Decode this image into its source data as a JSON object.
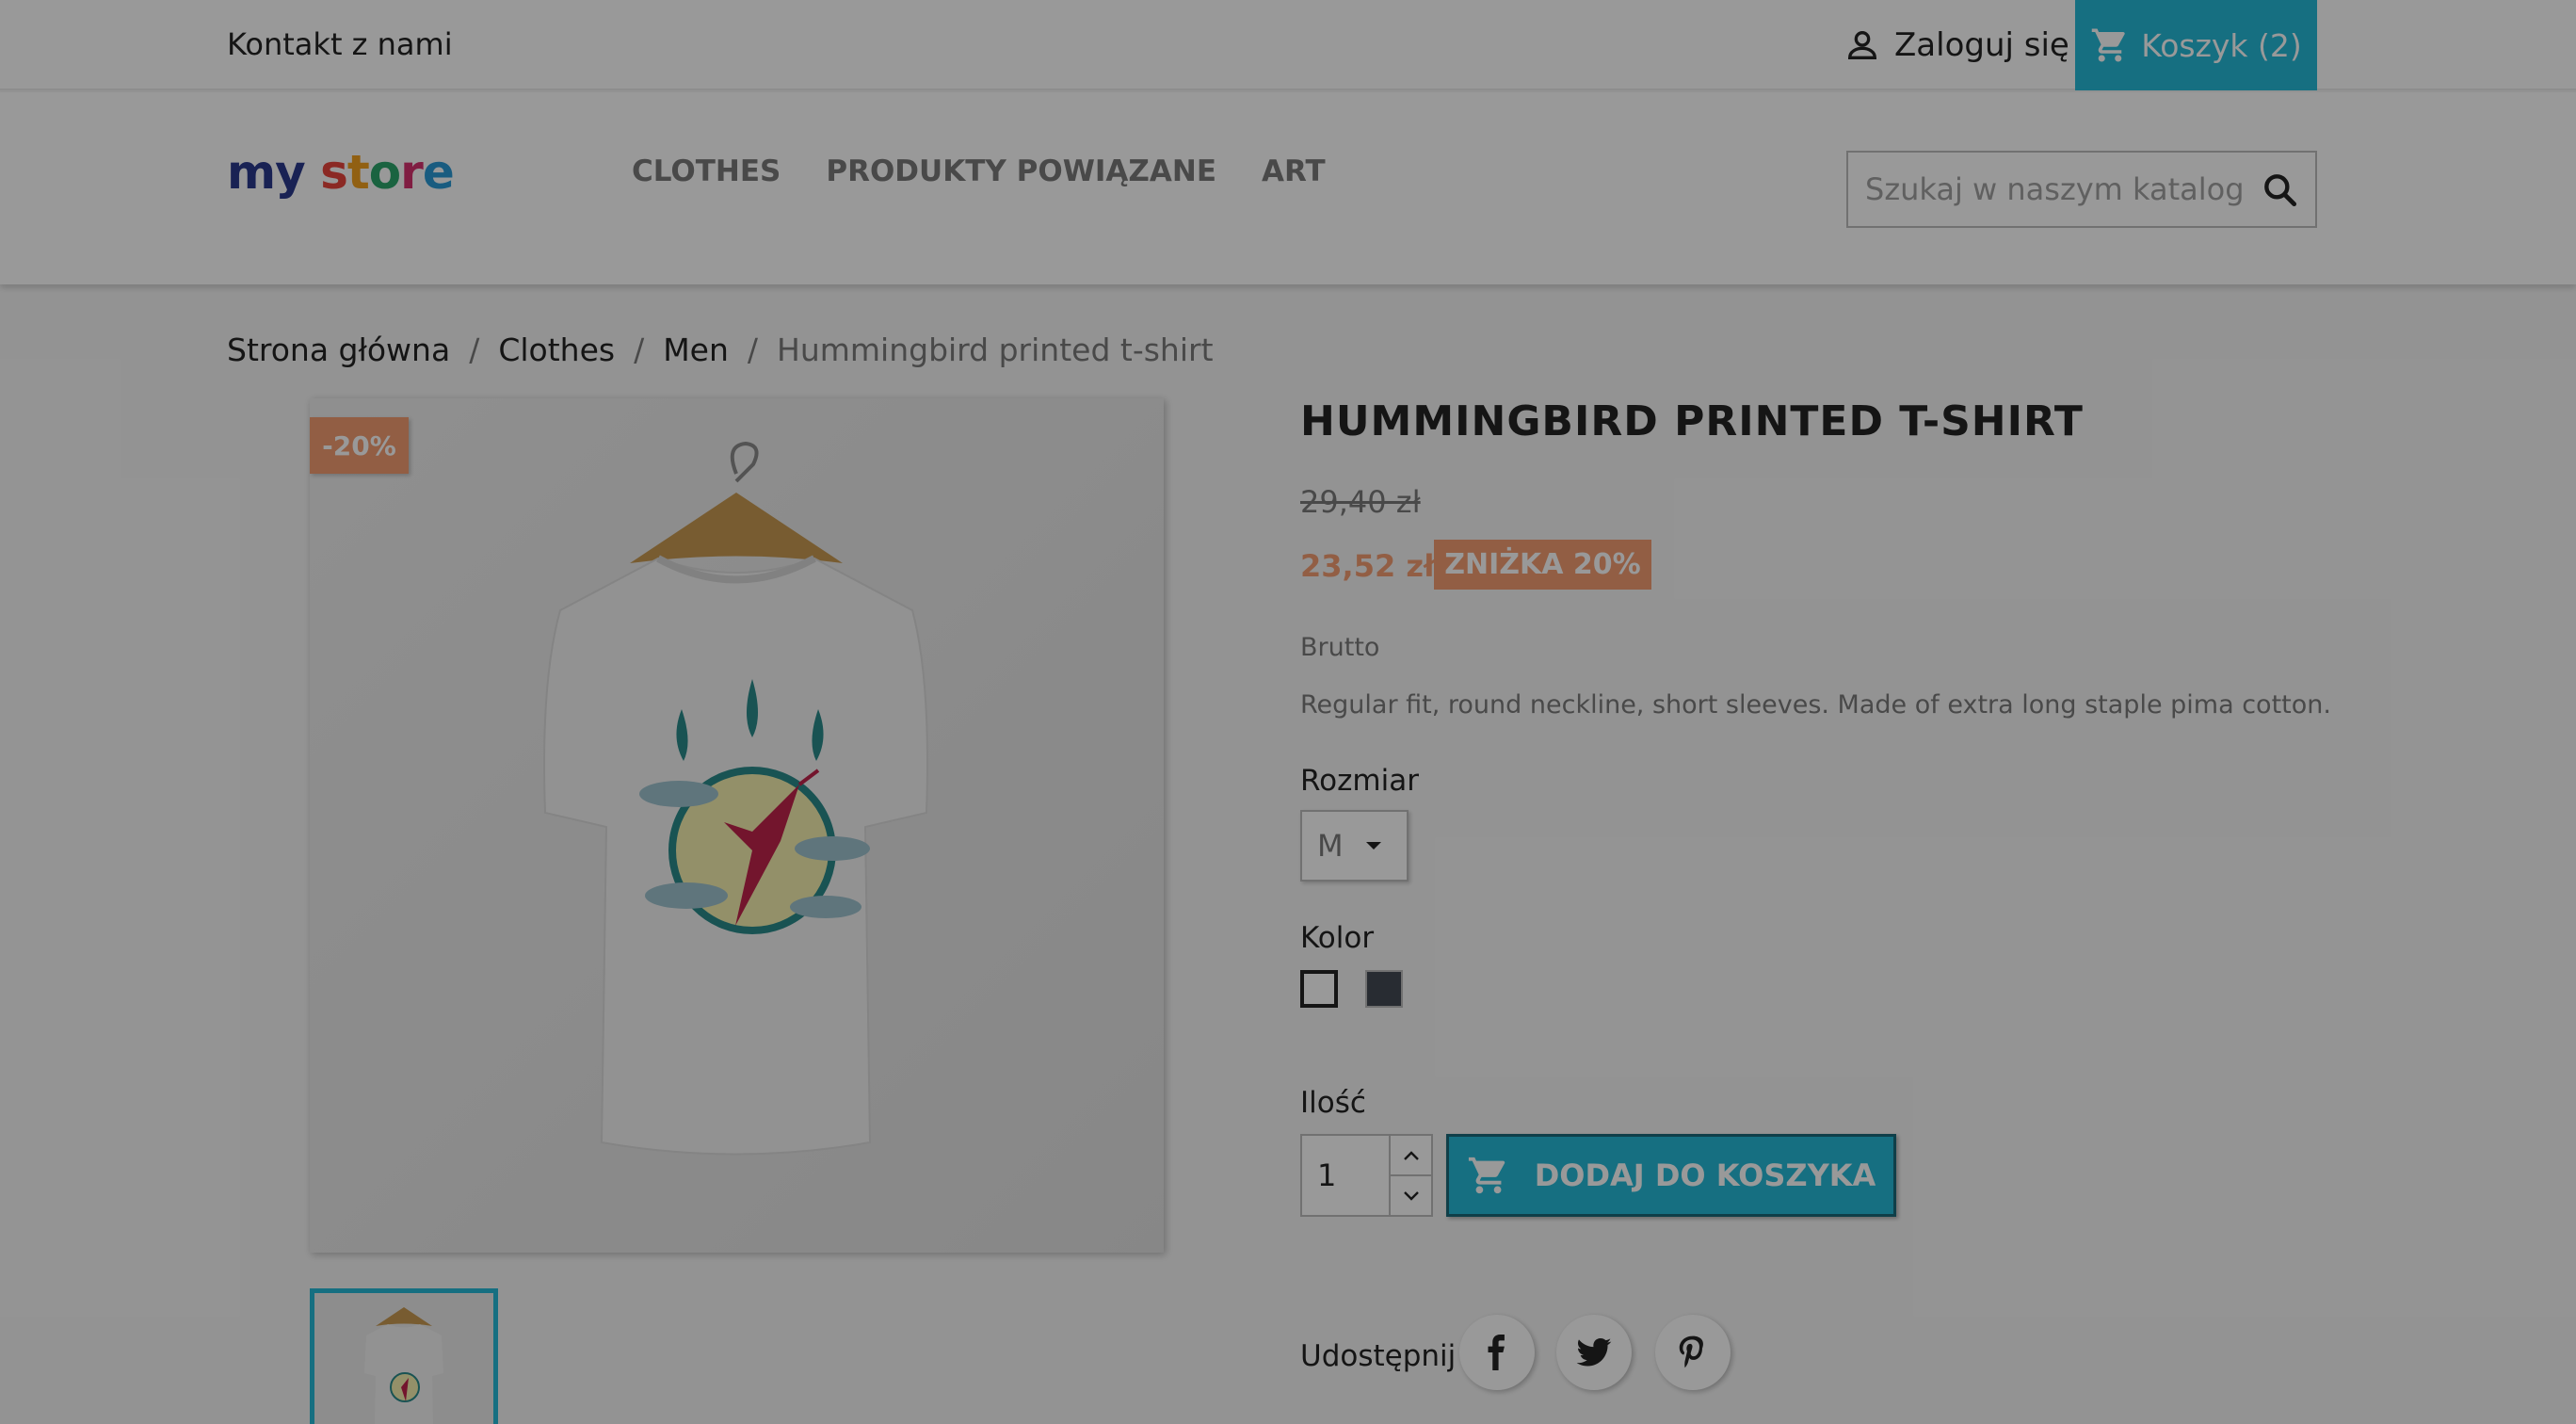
{
  "topbar": {
    "contact": "Kontakt z nami",
    "signin": "Zaloguj się",
    "cart": "Koszyk (2)"
  },
  "header": {
    "logo": {
      "my": "my",
      "s": "s",
      "t": "t",
      "o": "o",
      "r": "r",
      "e": "e"
    },
    "nav": [
      "CLOTHES",
      "PRODUKTY POWIĄZANE",
      "ART"
    ],
    "search_placeholder": "Szukaj w naszym katalogu"
  },
  "breadcrumb": [
    "Strona główna",
    "Clothes",
    "Men",
    "Hummingbird printed t-shirt"
  ],
  "breadcrumb_sep": "/",
  "product": {
    "flag": "-20%",
    "title": "HUMMINGBIRD PRINTED T-SHIRT",
    "old_price": "29,40 zł",
    "new_price": "23,52 zł",
    "discount": "ZNIŻKA 20%",
    "tax": "Brutto",
    "description": "Regular fit, round neckline, short sleeves. Made of extra long staple pima cotton.",
    "size_label": "Rozmiar",
    "size_value": "M",
    "color_label": "Kolor",
    "colors": [
      "#ffffff",
      "#434a54"
    ],
    "qty_label": "Ilość",
    "qty_value": "1",
    "add_to_cart": "DODAJ DO KOSZYKA",
    "share_label": "Udostępnij"
  },
  "icons": {
    "user": "user-icon",
    "cart": "cart-icon",
    "search": "search-icon",
    "facebook": "facebook-icon",
    "twitter": "twitter-icon",
    "pinterest": "pinterest-icon"
  },
  "colors": {
    "accent": "#25b9d7",
    "sale": "#f39d72",
    "overlay": "rgba(0,0,0,0.4)"
  }
}
